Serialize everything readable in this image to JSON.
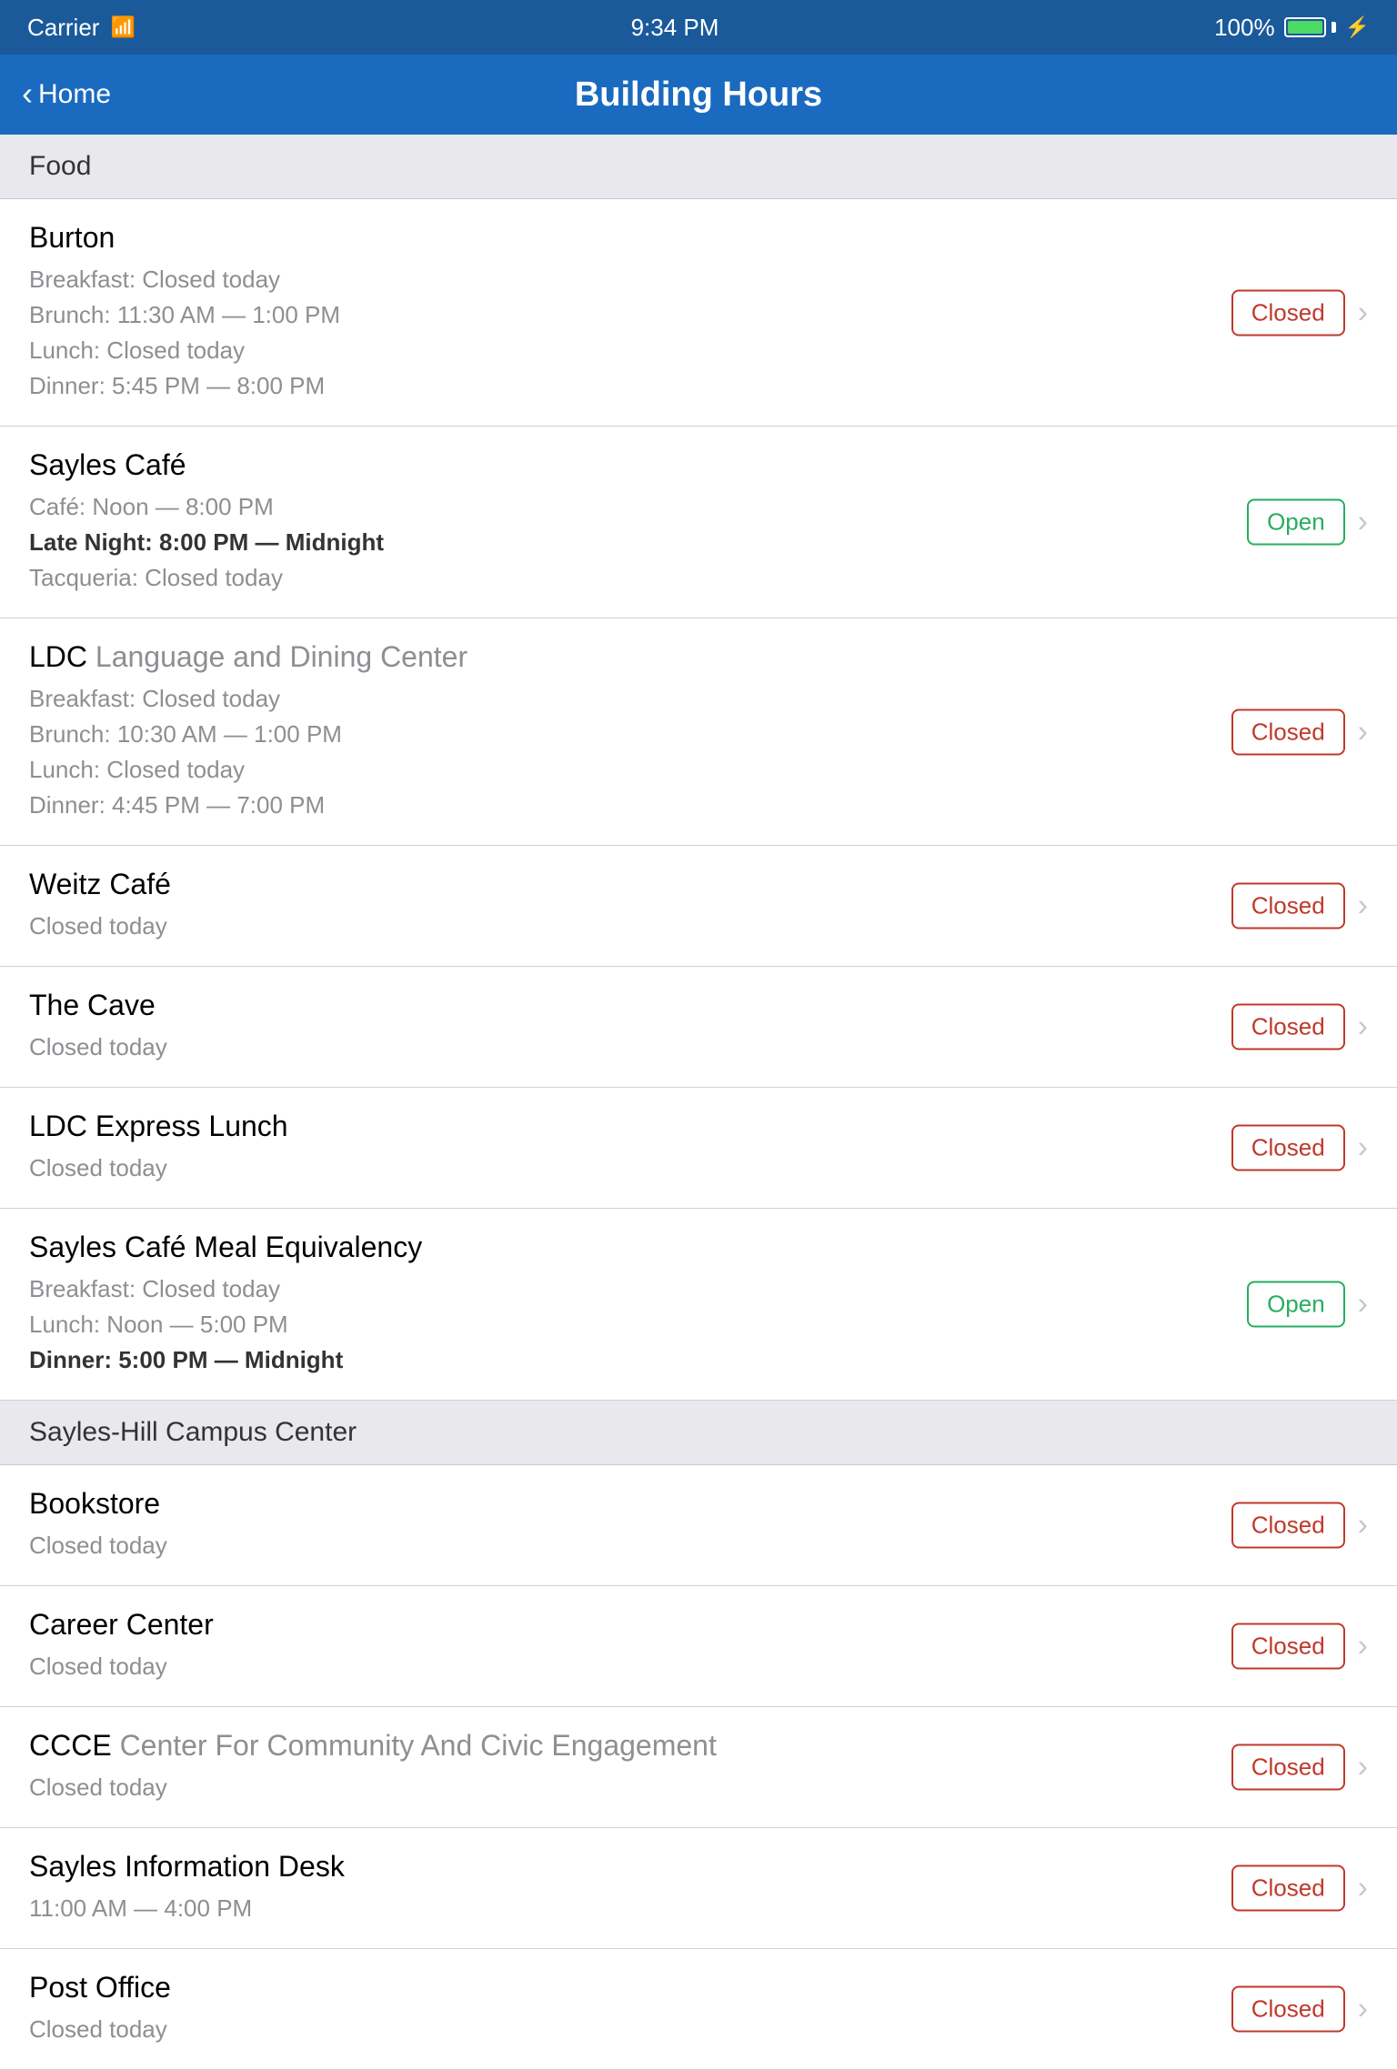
{
  "statusBar": {
    "carrier": "Carrier",
    "time": "9:34 PM",
    "battery": "100%"
  },
  "navBar": {
    "title": "Building Hours",
    "backLabel": "Home"
  },
  "sections": [
    {
      "id": "food",
      "header": "Food",
      "items": [
        {
          "id": "burton",
          "title": "Burton",
          "titleGray": "",
          "status": "Closed",
          "statusType": "closed",
          "details": [
            {
              "text": "Breakfast: Closed today",
              "bold": false
            },
            {
              "text": "Brunch: 11:30 AM — 1:00 PM",
              "bold": false
            },
            {
              "text": "Lunch: Closed today",
              "bold": false
            },
            {
              "text": "Dinner: 5:45 PM — 8:00 PM",
              "bold": false
            }
          ]
        },
        {
          "id": "sayles-cafe",
          "title": "Sayles Café",
          "titleGray": "",
          "status": "Open",
          "statusType": "open",
          "details": [
            {
              "text": "Café: Noon — 8:00 PM",
              "bold": false
            },
            {
              "text": "Late Night: 8:00 PM — Midnight",
              "bold": true
            },
            {
              "text": "Tacqueria: Closed today",
              "bold": false
            }
          ]
        },
        {
          "id": "ldc",
          "title": "LDC",
          "titleGray": " Language and Dining Center",
          "status": "Closed",
          "statusType": "closed",
          "details": [
            {
              "text": "Breakfast: Closed today",
              "bold": false
            },
            {
              "text": "Brunch: 10:30 AM — 1:00 PM",
              "bold": false
            },
            {
              "text": "Lunch: Closed today",
              "bold": false
            },
            {
              "text": "Dinner: 4:45 PM — 7:00 PM",
              "bold": false
            }
          ]
        },
        {
          "id": "weitz-cafe",
          "title": "Weitz Café",
          "titleGray": "",
          "status": "Closed",
          "statusType": "closed",
          "details": [
            {
              "text": "Closed today",
              "bold": false
            }
          ]
        },
        {
          "id": "the-cave",
          "title": "The Cave",
          "titleGray": "",
          "status": "Closed",
          "statusType": "closed",
          "details": [
            {
              "text": "Closed today",
              "bold": false
            }
          ]
        },
        {
          "id": "ldc-express",
          "title": "LDC Express Lunch",
          "titleGray": "",
          "status": "Closed",
          "statusType": "closed",
          "details": [
            {
              "text": "Closed today",
              "bold": false
            }
          ]
        },
        {
          "id": "sayles-meal",
          "title": "Sayles Café Meal Equivalency",
          "titleGray": "",
          "status": "Open",
          "statusType": "open",
          "details": [
            {
              "text": "Breakfast: Closed today",
              "bold": false
            },
            {
              "text": "Lunch: Noon — 5:00 PM",
              "bold": false
            },
            {
              "text": "Dinner: 5:00 PM — Midnight",
              "bold": true
            }
          ]
        }
      ]
    },
    {
      "id": "sayles-hill",
      "header": "Sayles-Hill Campus Center",
      "items": [
        {
          "id": "bookstore",
          "title": "Bookstore",
          "titleGray": "",
          "status": "Closed",
          "statusType": "closed",
          "details": [
            {
              "text": "Closed today",
              "bold": false
            }
          ]
        },
        {
          "id": "career-center",
          "title": "Career Center",
          "titleGray": "",
          "status": "Closed",
          "statusType": "closed",
          "details": [
            {
              "text": "Closed today",
              "bold": false
            }
          ]
        },
        {
          "id": "ccce",
          "title": "CCCE",
          "titleGray": " Center For Community And Civic Engagement",
          "status": "Closed",
          "statusType": "closed",
          "details": [
            {
              "text": "Closed today",
              "bold": false
            }
          ]
        },
        {
          "id": "sayles-info",
          "title": "Sayles Information Desk",
          "titleGray": "",
          "status": "Closed",
          "statusType": "closed",
          "details": [
            {
              "text": "11:00 AM — 4:00 PM",
              "bold": false
            }
          ]
        },
        {
          "id": "post-office",
          "title": "Post Office",
          "titleGray": "",
          "status": "Closed",
          "statusType": "closed",
          "details": [
            {
              "text": "Closed today",
              "bold": false
            }
          ]
        }
      ]
    }
  ]
}
